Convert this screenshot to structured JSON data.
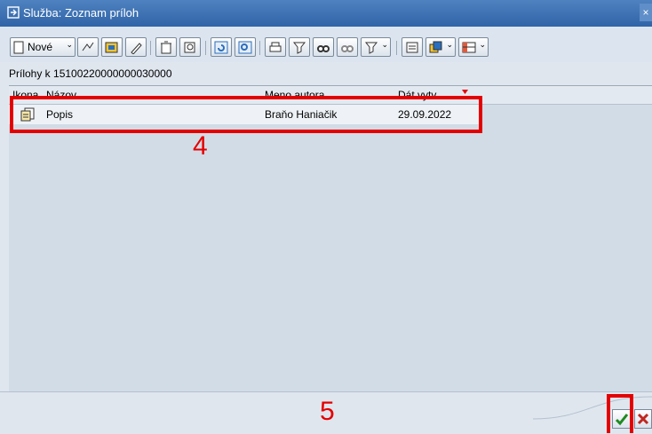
{
  "window": {
    "title": "Služba: Zoznam príloh",
    "close_glyph": "×"
  },
  "toolbar": {
    "new_label": "Nové",
    "dropdown_glyph": "⌄",
    "icons": [
      "new-doc-icon",
      "link-icon",
      "display-icon",
      "edit-pencil-icon",
      "delete-trash-icon",
      "detail-icon",
      "refresh-icon",
      "zoom-icon",
      "print-icon",
      "filter-icon",
      "find-icon",
      "find-next-icon",
      "set-filter-icon",
      "export-icon",
      "copy-icon",
      "layout-icon"
    ]
  },
  "caption": "Prílohy k 15100220000000030000",
  "table": {
    "columns": [
      "Ikona",
      "Názov",
      "Meno autora",
      "Dát.vytv."
    ],
    "rows": [
      {
        "icon": "attachment-doc-icon",
        "name": "Popis",
        "author": "Braňo Haniačik",
        "date": "29.09.2022"
      }
    ]
  },
  "annotations": {
    "row_marker": "4",
    "button_marker": "5"
  },
  "colors": {
    "accent_red": "#e40000",
    "title_blue": "#2f64a8",
    "grid_bg": "#d2dce7"
  }
}
